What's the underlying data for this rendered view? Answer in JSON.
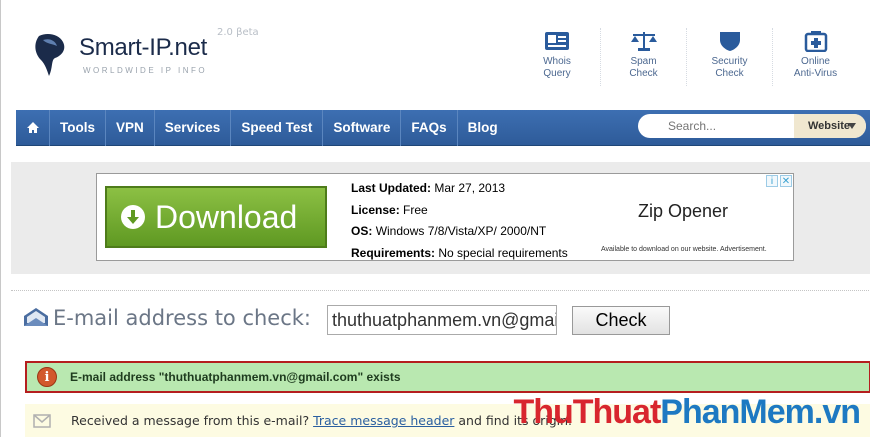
{
  "header": {
    "logo_title": "Smart-IP.net",
    "logo_subtitle": "WORLDWIDE IP INFO",
    "version": "2.0 βeta",
    "tools": [
      {
        "label": "Whois\nQuery",
        "icon": "id-card-icon"
      },
      {
        "label": "Spam\nCheck",
        "icon": "scales-icon"
      },
      {
        "label": "Security\nCheck",
        "icon": "shield-icon"
      },
      {
        "label": "Online\nAnti-Virus",
        "icon": "antivirus-icon"
      }
    ]
  },
  "nav": {
    "items": [
      "Tools",
      "VPN",
      "Services",
      "Speed Test",
      "Software",
      "FAQs",
      "Blog"
    ],
    "search_placeholder": "Search...",
    "search_scope": "Website"
  },
  "ad": {
    "button_label": "Download",
    "last_updated_label": "Last Updated:",
    "last_updated_value": "Mar 27, 2013",
    "license_label": "License:",
    "license_value": "Free",
    "os_label": "OS:",
    "os_value": "Windows 7/8/Vista/XP/ 2000/NT",
    "requirements_label": "Requirements:",
    "requirements_value": "No special requirements",
    "title": "Zip Opener",
    "note": "Available to download on our website. Advertisement."
  },
  "check": {
    "label": "E-mail address to check:",
    "email_value": "thuthuatphanmem.vn@gmail.com",
    "button_label": "Check"
  },
  "result": {
    "message": "E-mail address \"thuthuatphanmem.vn@gmail.com\" exists"
  },
  "received": {
    "text": "Received a message from this e-mail?",
    "link": "Trace message header",
    "rest": "and find its origin."
  },
  "watermark": {
    "part1": "ThuThuat",
    "part2": "PhanMem.vn"
  },
  "colors": {
    "nav_bg": "#3567a8",
    "result_bg": "#b9e8b0",
    "result_border": "#b51e1e",
    "download_green": "#6fa82d"
  }
}
